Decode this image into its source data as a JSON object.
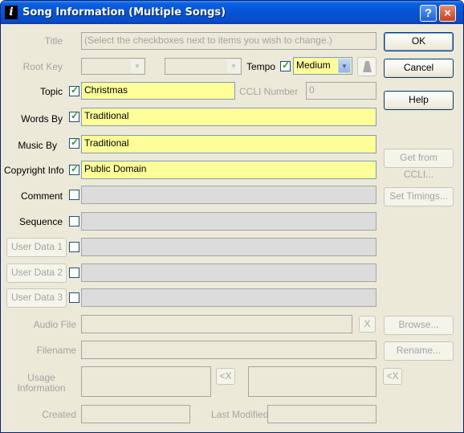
{
  "window": {
    "title": "Song Information (Multiple Songs)",
    "icon": "info-icon",
    "help_button": "?",
    "close_button": "×"
  },
  "fields": {
    "title": {
      "label": "Title",
      "placeholder": "(Select the checkboxes next to items you wish to change.)"
    },
    "root_key": {
      "label": "Root Key",
      "value1": "",
      "value2": ""
    },
    "tempo": {
      "label": "Tempo",
      "checked": true,
      "value": "Medium"
    },
    "topic": {
      "label": "Topic",
      "checked": true,
      "value": "Christmas"
    },
    "ccli_number": {
      "label": "CCLI Number",
      "value": "0"
    },
    "words_by": {
      "label": "Words By",
      "checked": true,
      "value": "Traditional"
    },
    "music_by": {
      "label": "Music By",
      "checked": true,
      "value": "Traditional"
    },
    "copyright_info": {
      "label": "Copyright Info",
      "checked": true,
      "value": "Public Domain"
    },
    "comment": {
      "label": "Comment",
      "checked": false,
      "value": ""
    },
    "sequence": {
      "label": "Sequence",
      "checked": false,
      "value": ""
    },
    "user_data_1": {
      "label": "User Data 1",
      "checked": false,
      "value": ""
    },
    "user_data_2": {
      "label": "User Data 2",
      "checked": false,
      "value": ""
    },
    "user_data_3": {
      "label": "User Data 3",
      "checked": false,
      "value": ""
    },
    "audio_file": {
      "label": "Audio File",
      "value": "",
      "clear_label": "X"
    },
    "filename": {
      "label": "Filename",
      "value": ""
    },
    "usage_information": {
      "label_line1": "Usage",
      "label_line2": "Information",
      "clear_label_1": "<X",
      "clear_label_2": "<X"
    },
    "created": {
      "label": "Created",
      "value": ""
    },
    "last_modified": {
      "label": "Last Modified",
      "value": ""
    }
  },
  "buttons": {
    "ok": "OK",
    "cancel": "Cancel",
    "help": "Help",
    "get_from_ccli": "Get from CCLI...",
    "set_timings": "Set Timings...",
    "browse": "Browse...",
    "rename": "Rename..."
  },
  "colors": {
    "titlebar": "#0a5fe0",
    "dialog_bg": "#ece9d8",
    "edited_field": "#ffff99",
    "disabled_field": "#dcdcdc",
    "checkmark": "#21a121"
  }
}
